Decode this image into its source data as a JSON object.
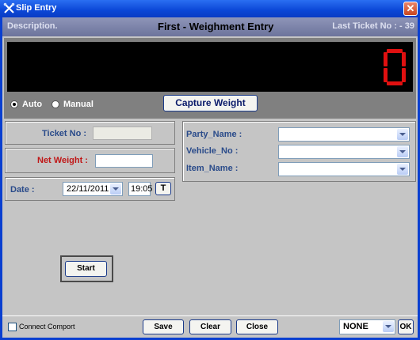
{
  "window": {
    "title": "Slip Entry",
    "close_glyph": "✕"
  },
  "header": {
    "description": "Description.",
    "title": "First - Weighment Entry",
    "last_ticket": "Last Ticket No : - 39"
  },
  "display": {
    "weight_digit": "0",
    "digit_color": "#e01010"
  },
  "mode": {
    "auto_label": "Auto",
    "manual_label": "Manual",
    "selected": "Auto"
  },
  "capture_button": "Capture Weight",
  "ticket": {
    "label": "Ticket No :",
    "value": ""
  },
  "net_weight": {
    "label": "Net Weight :",
    "value": ""
  },
  "date": {
    "label": "Date :",
    "date_value": "22/11/2011",
    "time_value": "19:05",
    "t_button": "T"
  },
  "party": {
    "party_label": "Party_Name :",
    "vehicle_label": "Vehicle_No :",
    "item_label": "Item_Name :"
  },
  "start_button": "Start",
  "footer": {
    "connect_label": "Connect Comport",
    "save": "Save",
    "clear": "Clear",
    "close": "Close",
    "port_value": "NONE",
    "ok": "OK"
  }
}
